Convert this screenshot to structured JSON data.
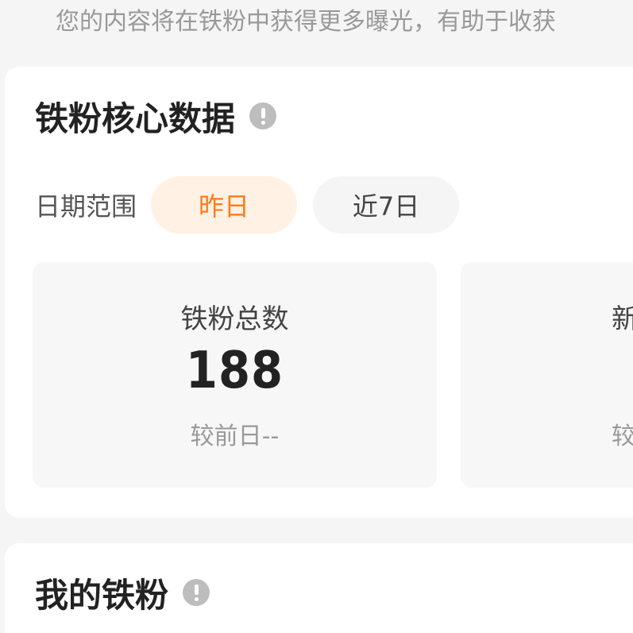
{
  "intro_text": "您的内容将在铁粉中获得更多曝光，有助于收获",
  "core_section": {
    "title": "铁粉核心数据",
    "range_label": "日期范围",
    "ranges": [
      {
        "label": "昨日",
        "active": true
      },
      {
        "label": "近7日",
        "active": false
      }
    ],
    "stats": [
      {
        "label": "铁粉总数",
        "value": "188",
        "compare": "较前日--"
      },
      {
        "label": "新增",
        "value": "",
        "compare": "较"
      }
    ]
  },
  "my_section": {
    "title": "我的铁粉"
  },
  "colors": {
    "accent": "#ff7a1a",
    "accent_bg": "#fff1e3",
    "page_bg": "#f5f5f5"
  }
}
